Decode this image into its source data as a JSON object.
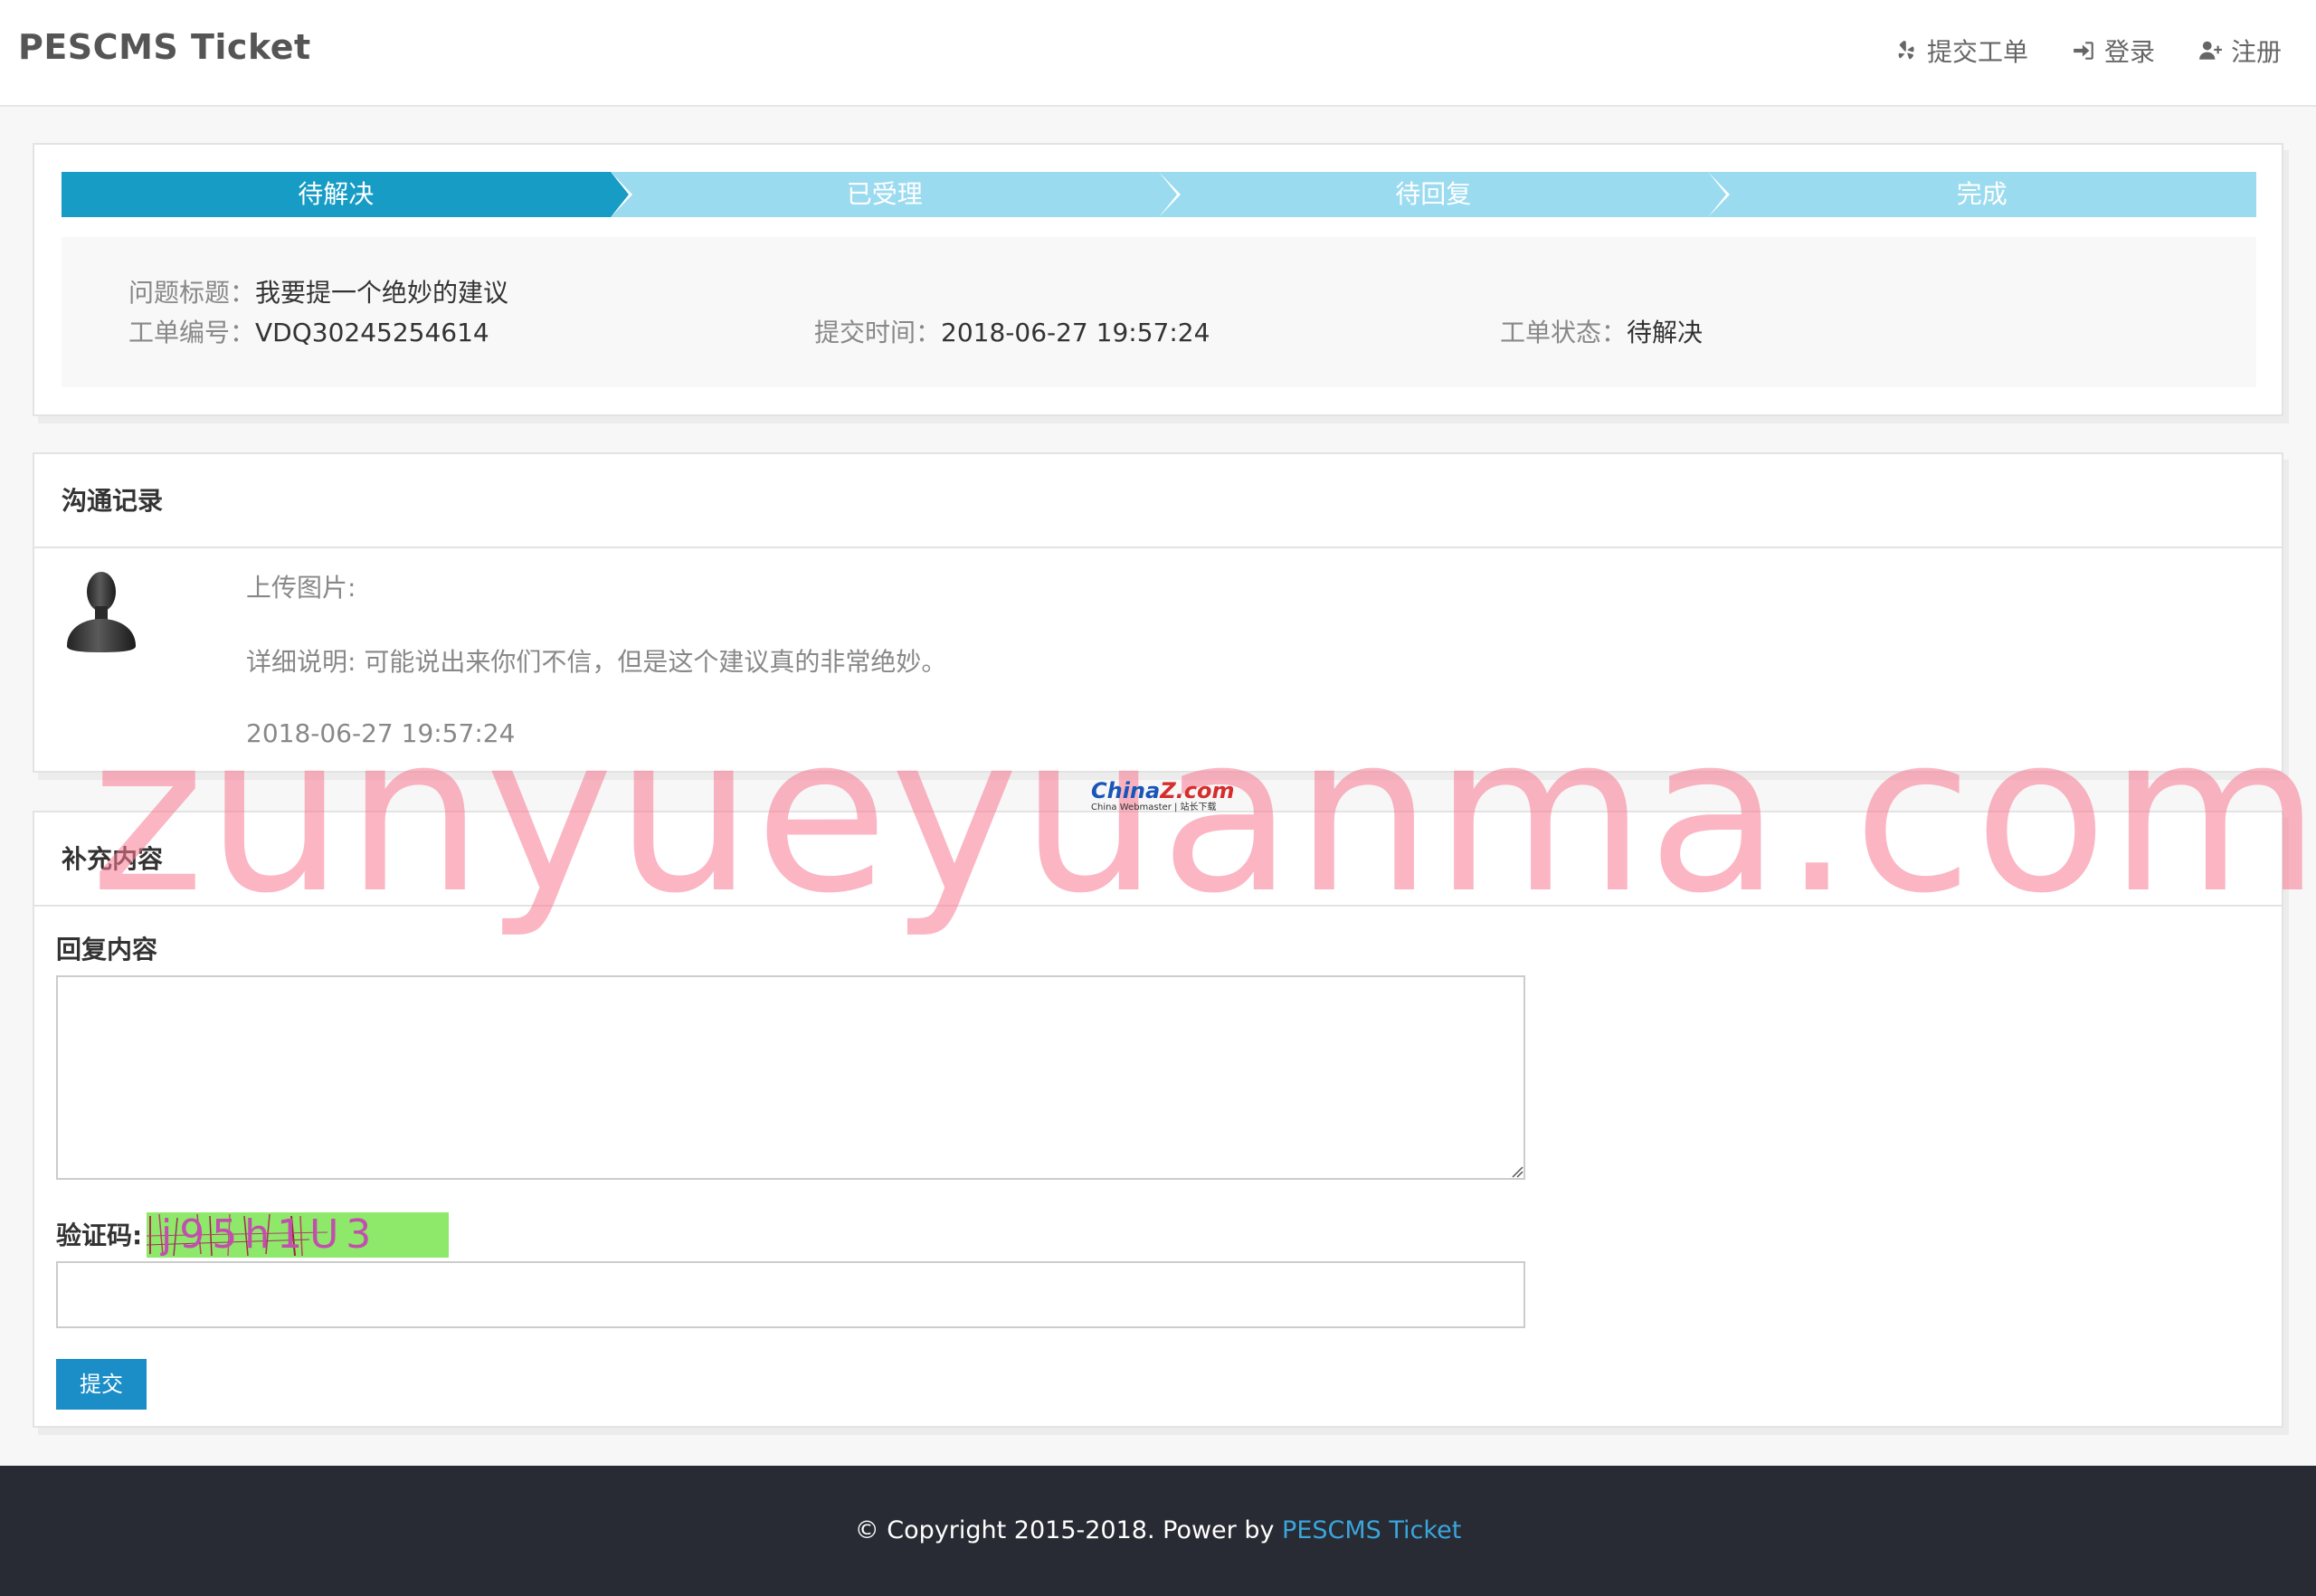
{
  "header": {
    "brand": "PESCMS Ticket",
    "nav": [
      {
        "label": "提交工单",
        "icon": "yelp-icon"
      },
      {
        "label": "登录",
        "icon": "sign-in-icon"
      },
      {
        "label": "注册",
        "icon": "user-plus-icon"
      }
    ]
  },
  "steps": [
    {
      "label": "待解决",
      "active": true
    },
    {
      "label": "已受理",
      "active": false
    },
    {
      "label": "待回复",
      "active": false
    },
    {
      "label": "完成",
      "active": false
    }
  ],
  "ticket": {
    "title_label": "问题标题：",
    "title_value": "我要提一个绝妙的建议",
    "number_label": "工单编号：",
    "number_value": "VDQ30245254614",
    "time_label": "提交时间：",
    "time_value": "2018-06-27 19:57:24",
    "status_label": "工单状态：",
    "status_value": "待解决"
  },
  "communication": {
    "heading": "沟通记录",
    "upload_label": "上传图片:",
    "detail": "详细说明: 可能说出来你们不信，但是这个建议真的非常绝妙。",
    "timestamp": "2018-06-27 19:57:24"
  },
  "reply": {
    "heading": "补充内容",
    "content_label": "回复内容",
    "content_value": "",
    "captcha_label": "验证码:",
    "captcha_text": "j95h1U3",
    "captcha_value": "",
    "submit_label": "提交"
  },
  "footer": {
    "copyright": "© Copyright 2015-2018. Power by ",
    "link": "PESCMS Ticket"
  },
  "overlay": {
    "watermark": "zunyueyuanma.com",
    "logo_main": "China",
    "logo_main_accent": "Z.com",
    "logo_sub": "China Webmaster | 站长下载"
  },
  "colors": {
    "step_active": "#169cc5",
    "step_inactive": "#9bdbef",
    "button": "#1b8ec8",
    "footer_bg": "#282b33",
    "footer_link": "#3aa6dc"
  }
}
